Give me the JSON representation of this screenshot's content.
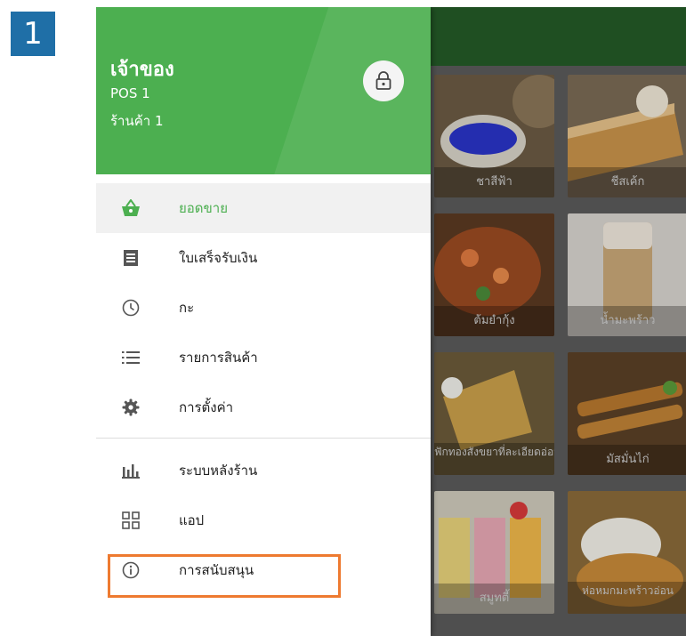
{
  "step": "1",
  "drawer": {
    "owner": "เจ้าของ",
    "pos": "POS 1",
    "store": "ร้านค้า 1",
    "menu_primary": [
      {
        "label": "ยอดขาย",
        "icon": "basket-icon",
        "active": true
      },
      {
        "label": "ใบเสร็จรับเงิน",
        "icon": "receipt-icon",
        "active": false
      },
      {
        "label": "กะ",
        "icon": "clock-icon",
        "active": false
      },
      {
        "label": "รายการสินค้า",
        "icon": "list-icon",
        "active": false
      },
      {
        "label": "การตั้งค่า",
        "icon": "gear-icon",
        "active": false
      }
    ],
    "menu_secondary": [
      {
        "label": "ระบบหลังร้าน",
        "icon": "bar-chart-icon"
      },
      {
        "label": "แอป",
        "icon": "apps-icon"
      },
      {
        "label": "การสนับสนุน",
        "icon": "info-icon"
      }
    ]
  },
  "items": [
    {
      "label": "ชาสีฟ้า"
    },
    {
      "label": "ชีสเค้ก"
    },
    {
      "label": "ต้มยำกุ้ง"
    },
    {
      "label": "น้ำมะพร้าว"
    },
    {
      "label": "ฟักทองสังขยาที่ละเอียดอ่อน"
    },
    {
      "label": "มัสมั่นไก่"
    },
    {
      "label": "สมูทตี้"
    },
    {
      "label": "ห่อหมกมะพร้าวอ่อน"
    }
  ],
  "colors": {
    "header_green": "#4caf50",
    "app_bar_green": "#1f4f22",
    "active_text": "#4caf50",
    "highlight_orange": "#ee7a30",
    "step_badge": "#1f6fa7"
  }
}
